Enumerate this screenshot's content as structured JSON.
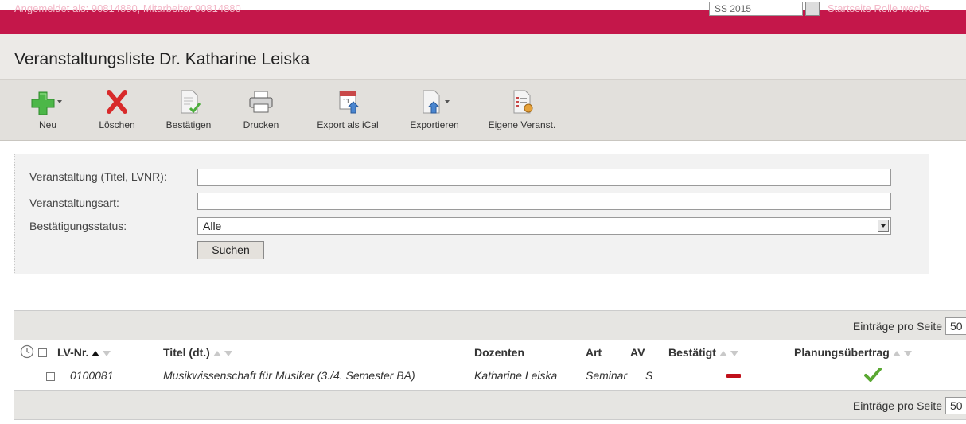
{
  "topbar": {
    "info": "Angemeldet als: 90814880, Mitarbeiter 90814880",
    "semester": "SS 2015",
    "links": "Startseite  Rolle wechs"
  },
  "page_title": "Veranstaltungsliste Dr. Katharine Leiska",
  "toolbar": {
    "new": "Neu",
    "delete": "Löschen",
    "confirm": "Bestätigen",
    "print": "Drucken",
    "ical": "Export als iCal",
    "export": "Exportieren",
    "own": "Eigene Veranst."
  },
  "filter": {
    "course_label": "Veranstaltung (Titel, LVNR):",
    "course_value": "",
    "type_label": "Veranstaltungsart:",
    "type_value": "",
    "status_label": "Bestätigungsstatus:",
    "status_value": "Alle",
    "search_button": "Suchen"
  },
  "grid": {
    "entries_label": "Einträge pro Seite",
    "entries_value": "50",
    "columns": {
      "lvnr": "LV-Nr.",
      "title": "Titel (dt.)",
      "lecturers": "Dozenten",
      "type": "Art",
      "av": "AV",
      "confirmed": "Bestätigt",
      "planning": "Planungsübertrag"
    },
    "rows": [
      {
        "lvnr": "0100081",
        "title": "Musikwissenschaft für Musiker (3./4. Semester BA)",
        "lecturers": "Katharine Leiska",
        "type": "Seminar",
        "av": "S"
      }
    ]
  },
  "colors": {
    "brand": "#c4174a",
    "confirmed_no": "#c0101a",
    "planning_yes": "#5aa832"
  }
}
